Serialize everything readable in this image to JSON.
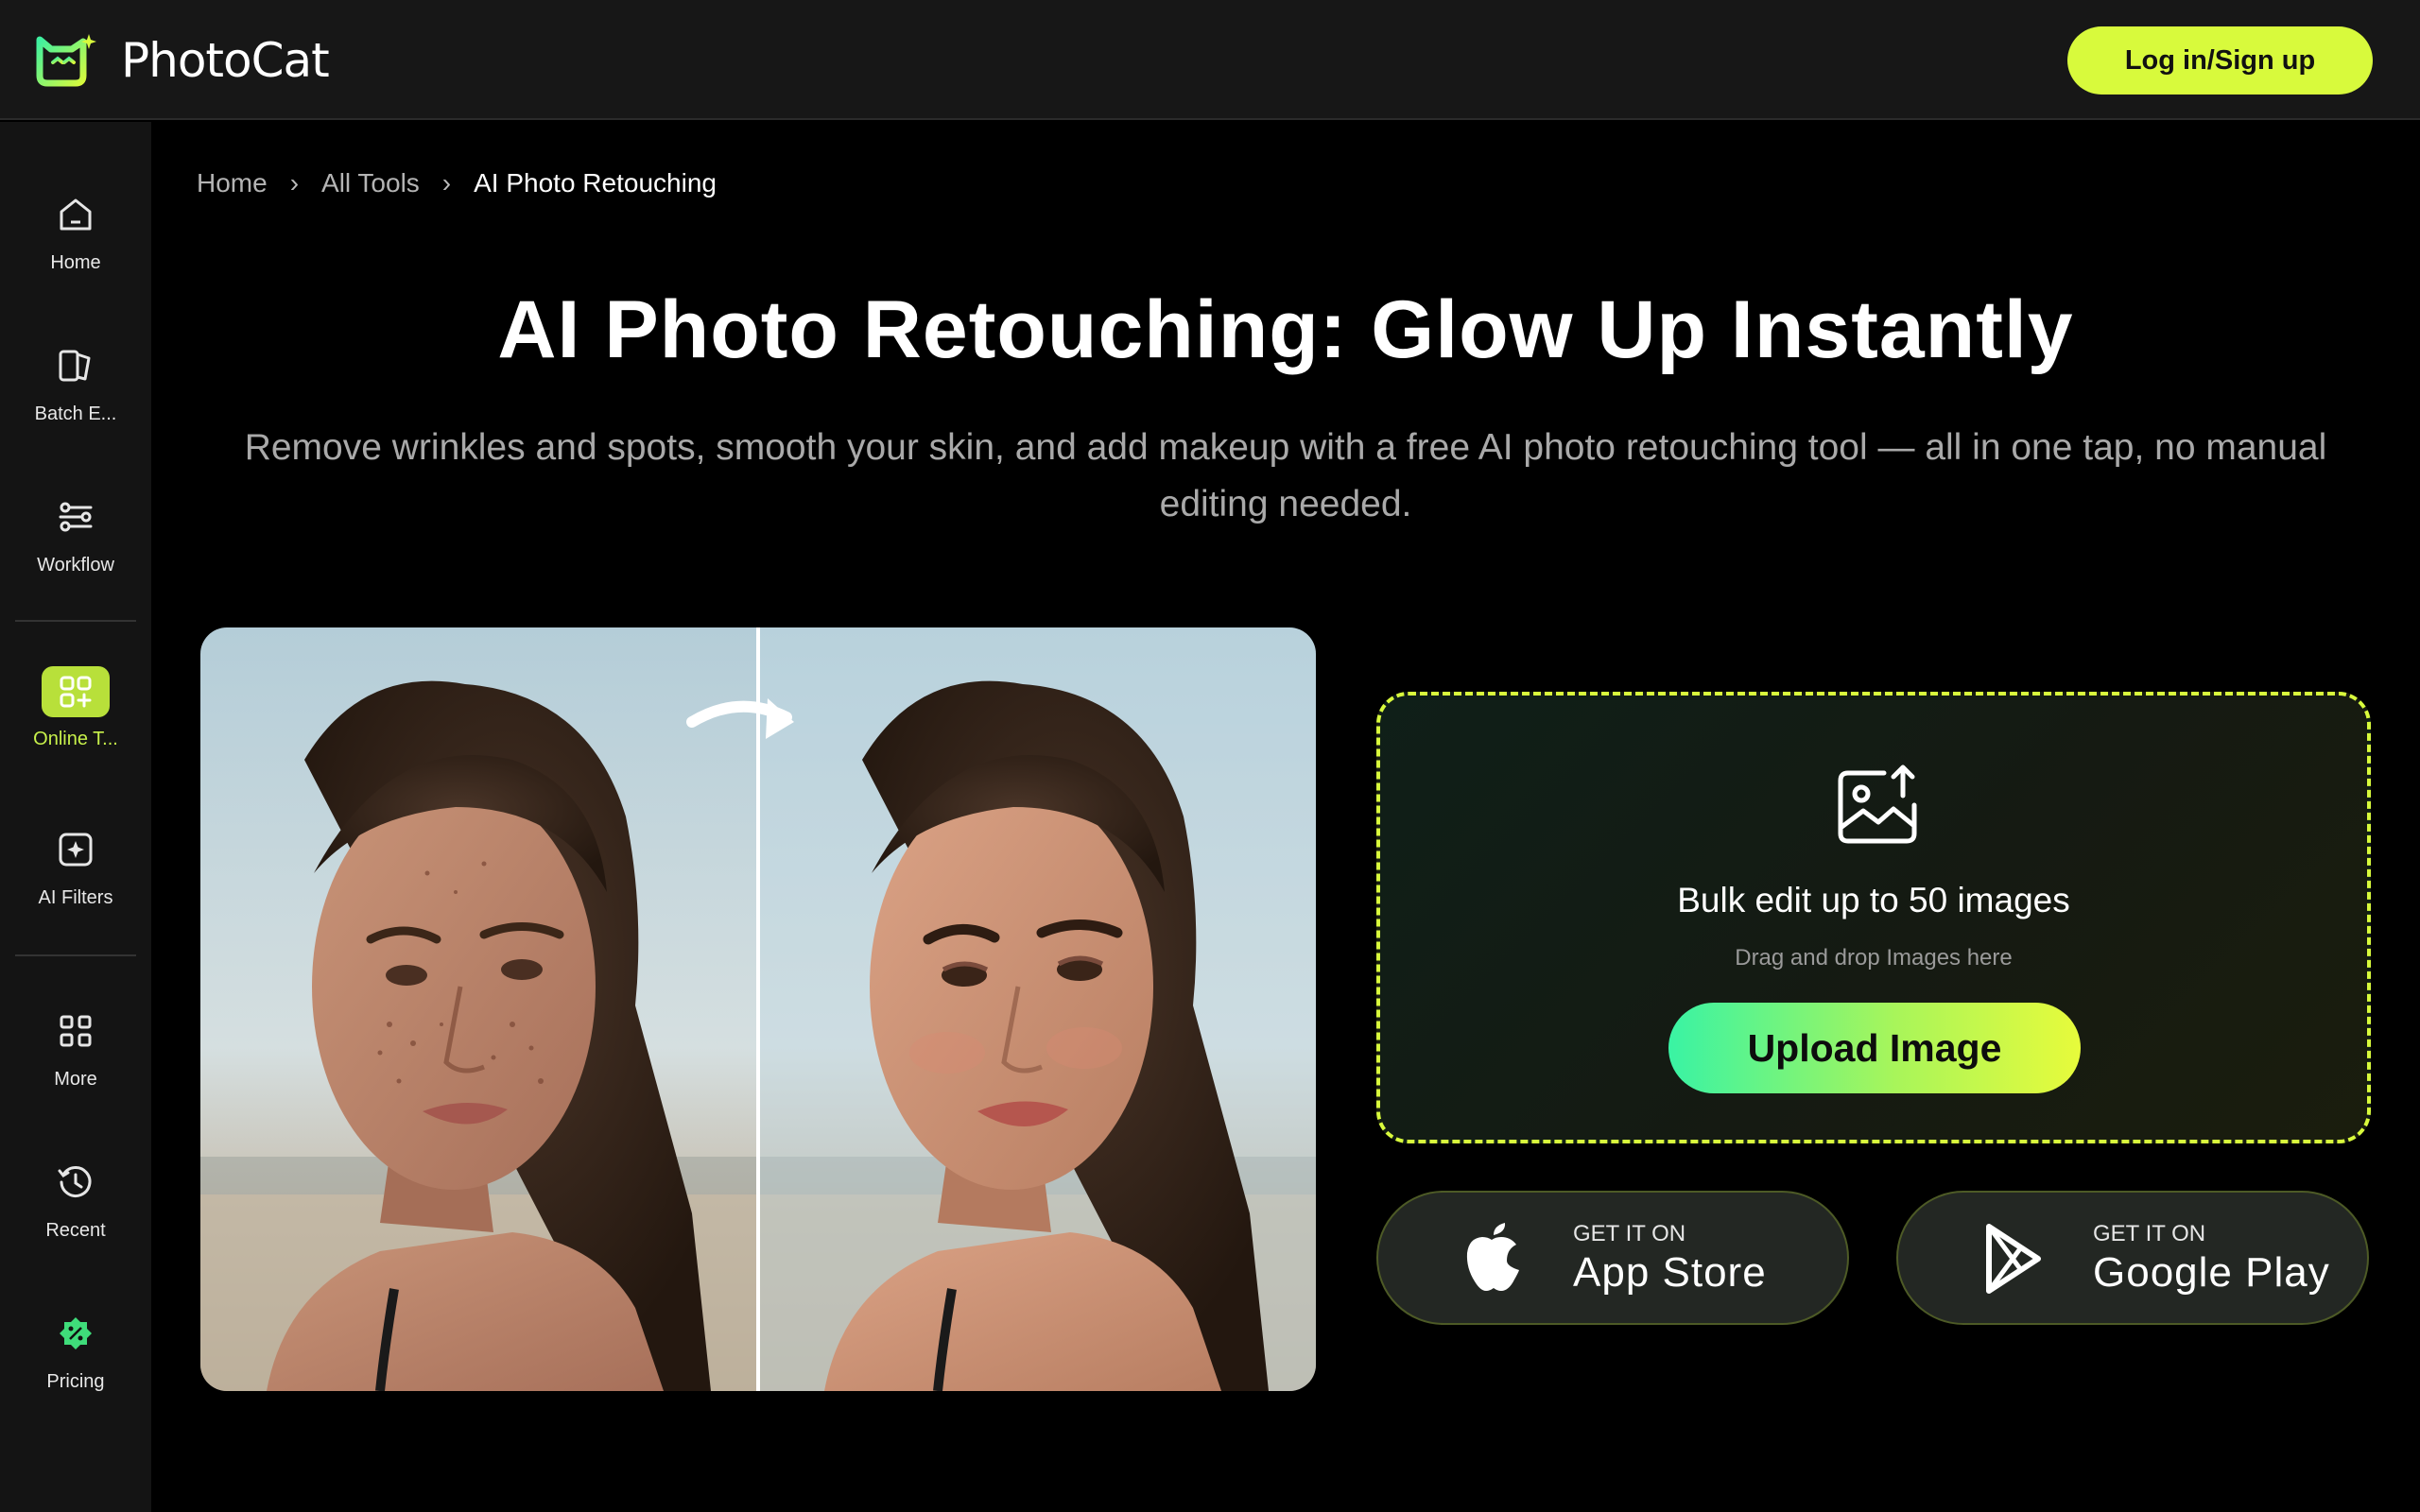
{
  "brand": {
    "name": "PhotoCat",
    "accent": "#d8fa3c"
  },
  "header": {
    "login_label": "Log in/Sign up"
  },
  "sidebar": {
    "items": [
      {
        "label": "Home",
        "icon": "home-icon"
      },
      {
        "label": "Batch E...",
        "icon": "batch-edit-icon"
      },
      {
        "label": "Workflow",
        "icon": "workflow-icon"
      },
      {
        "label": "Online T...",
        "icon": "online-tools-icon",
        "active": true
      },
      {
        "label": "AI Filters",
        "icon": "ai-filters-icon"
      },
      {
        "label": "More",
        "icon": "grid-icon"
      },
      {
        "label": "Recent",
        "icon": "history-icon"
      },
      {
        "label": "Pricing",
        "icon": "pricing-icon"
      }
    ]
  },
  "breadcrumb": {
    "home": "Home",
    "tools": "All Tools",
    "current": "AI Photo Retouching"
  },
  "hero": {
    "title": "AI Photo Retouching: Glow Up Instantly",
    "subtitle": "Remove wrinkles and spots, smooth your skin, and add makeup with a free AI photo retouching tool — all in one tap, no manual editing needed."
  },
  "upload": {
    "title": "Bulk edit up to 50 images",
    "hint": "Drag and drop Images here",
    "button_label": "Upload Image"
  },
  "stores": {
    "apple": {
      "small": "GET IT ON",
      "big": "App Store",
      "icon": "apple-icon"
    },
    "google": {
      "small": "GET IT ON",
      "big": "Google Play",
      "icon": "google-play-icon"
    }
  }
}
